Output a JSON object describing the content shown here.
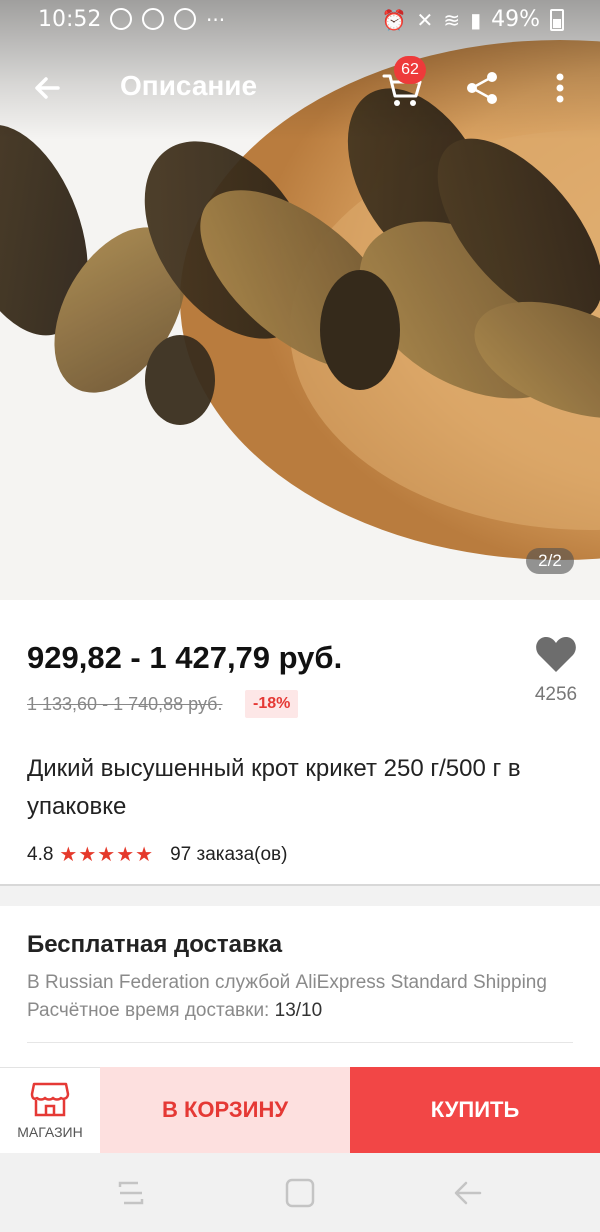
{
  "status_bar": {
    "time": "10:52",
    "battery": "49%"
  },
  "app_bar": {
    "title": "Описание",
    "cart_count": "62"
  },
  "gallery": {
    "page_indicator": "2/2"
  },
  "product": {
    "price": "929,82 - 1 427,79 руб.",
    "old_price": "1 133,60 - 1 740,88 руб.",
    "discount": "-18%",
    "wishlist_count": "4256",
    "title": "Дикий высушенный крот крикет 250 г/500 г в упаковке",
    "rating": "4.8",
    "rating_stars": 5,
    "orders": "97 заказа(ов)"
  },
  "shipping": {
    "title": "Бесплатная доставка",
    "line": "В Russian Federation службой AliExpress Standard Shipping",
    "time_label": "Расчётное время доставки:",
    "time_value": "13/10"
  },
  "actions": {
    "store_label": "МАГАЗИН",
    "add_to_cart": "В КОРЗИНУ",
    "buy": "КУПИТЬ"
  },
  "colors": {
    "accent_red": "#f24646",
    "light_red": "#fde0df",
    "star_red": "#e5392b"
  },
  "icons": [
    "back-arrow-icon",
    "cart-icon",
    "share-icon",
    "more-vert-icon",
    "heart-icon",
    "store-icon",
    "star-icon"
  ]
}
